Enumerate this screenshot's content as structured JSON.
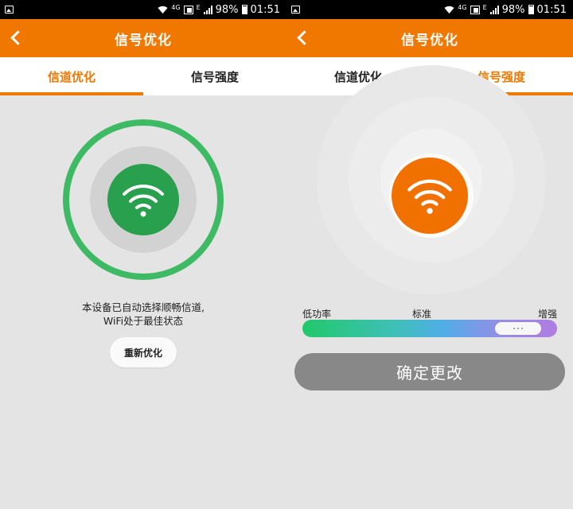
{
  "statusbar": {
    "battery": "98%",
    "time": "01:51",
    "network_4g": "4G",
    "network_e": "E"
  },
  "left": {
    "title": "信号优化",
    "tabs": [
      {
        "label": "信道优化",
        "active": true
      },
      {
        "label": "信号强度",
        "active": false
      }
    ],
    "description_line1": "本设备已自动选择顺畅信道,",
    "description_line2": "WiFi处于最佳状态",
    "reoptimize_label": "重新优化"
  },
  "right": {
    "title": "信号优化",
    "tabs": [
      {
        "label": "信道优化",
        "active": false
      },
      {
        "label": "信号强度",
        "active": true
      }
    ],
    "power": {
      "low_label": "低功率",
      "standard_label": "标准",
      "high_label": "增强",
      "level_fraction": 1.0
    },
    "confirm_label": "确定更改"
  },
  "colors": {
    "accent": "#f07700",
    "green_ring": "#3dba63",
    "green_core": "#29a04e",
    "orange_core": "#f07000",
    "confirm_bg": "#888888"
  },
  "icons": {
    "back": "chevron-left-icon",
    "wifi": "wifi-icon"
  }
}
